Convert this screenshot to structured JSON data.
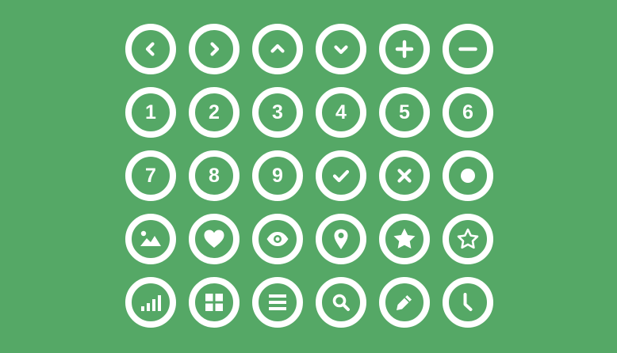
{
  "background_color": "#55a866",
  "icon_color": "#ffffff",
  "rows": [
    [
      "chevron-left-icon",
      "chevron-right-icon",
      "chevron-up-icon",
      "chevron-down-icon",
      "plus-icon",
      "minus-icon"
    ],
    [
      "1",
      "2",
      "3",
      "4",
      "5",
      "6"
    ],
    [
      "7",
      "8",
      "9",
      "check-icon",
      "close-icon",
      "record-dot-icon"
    ],
    [
      "image-icon",
      "heart-icon",
      "eye-icon",
      "location-pin-icon",
      "star-filled-icon",
      "star-outline-icon"
    ],
    [
      "signal-bars-icon",
      "grid-icon",
      "menu-list-icon",
      "search-icon",
      "pencil-icon",
      "clock-icon"
    ]
  ],
  "numbers": {
    "n1": "1",
    "n2": "2",
    "n3": "3",
    "n4": "4",
    "n5": "5",
    "n6": "6",
    "n7": "7",
    "n8": "8",
    "n9": "9"
  }
}
